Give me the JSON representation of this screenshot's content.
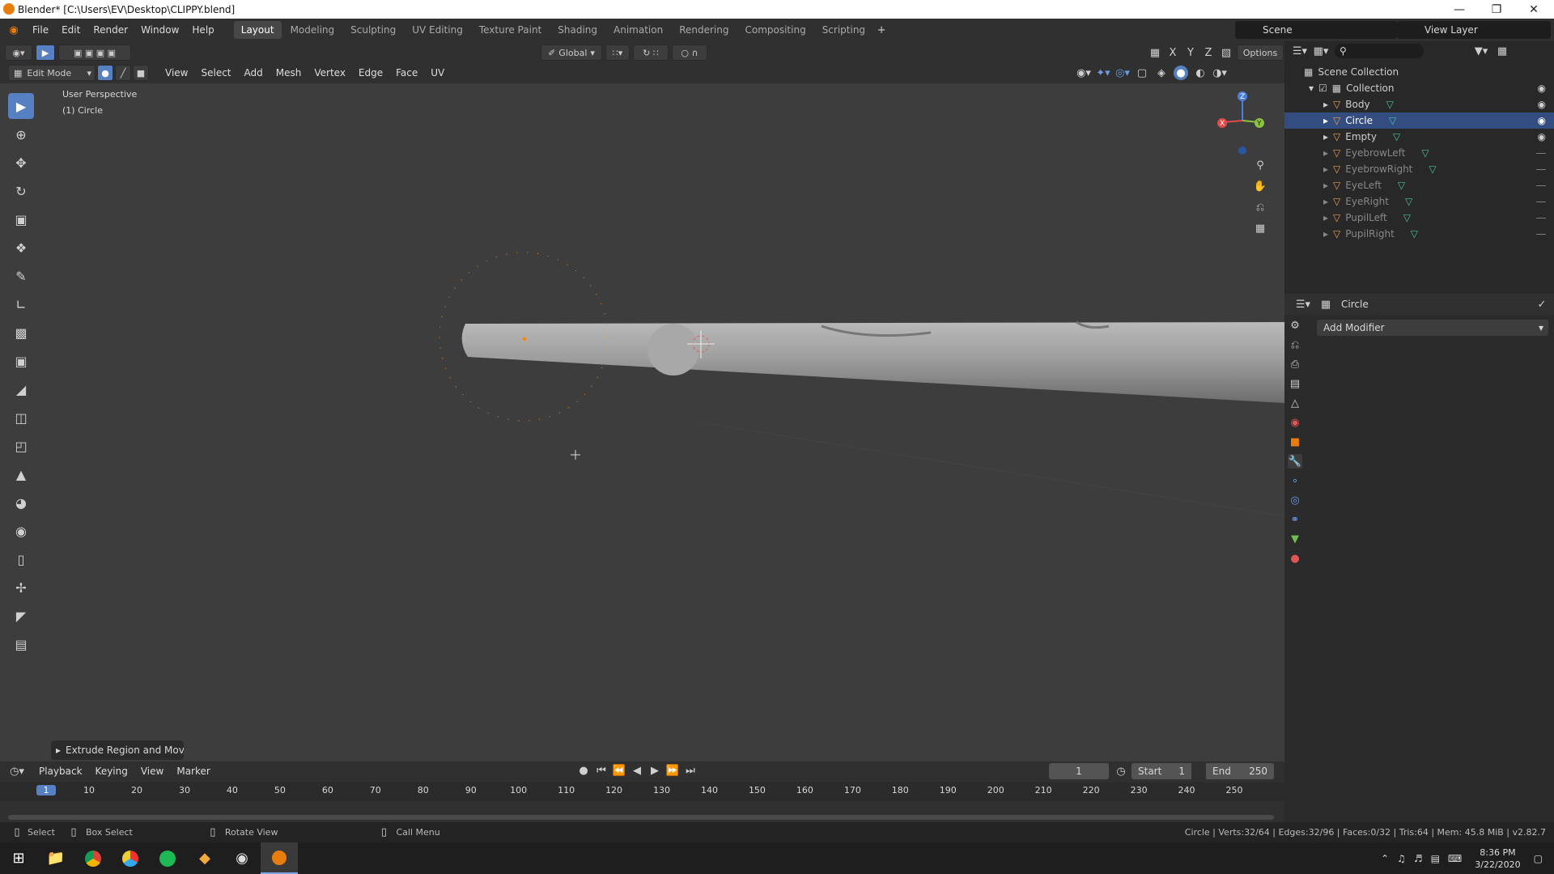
{
  "window": {
    "title": "Blender* [C:\\Users\\EV\\Desktop\\CLIPPY.blend]"
  },
  "menu": [
    "File",
    "Edit",
    "Render",
    "Window",
    "Help"
  ],
  "workspaces": [
    "Layout",
    "Modeling",
    "Sculpting",
    "UV Editing",
    "Texture Paint",
    "Shading",
    "Animation",
    "Rendering",
    "Compositing",
    "Scripting"
  ],
  "scene": {
    "scene_label": "Scene",
    "view_layer_label": "View Layer"
  },
  "header": {
    "transform_orientation": "Global",
    "options_label": "Options",
    "axes": [
      "X",
      "Y",
      "Z"
    ]
  },
  "editmode": {
    "mode_label": "Edit Mode",
    "menus": [
      "View",
      "Select",
      "Add",
      "Mesh",
      "Vertex",
      "Edge",
      "Face",
      "UV"
    ]
  },
  "viewport": {
    "perspective_label": "User Perspective",
    "object_label": "(1) Circle",
    "last_op_label": "Extrude Region and Mov"
  },
  "outliner": {
    "root": "Scene Collection",
    "collection": "Collection",
    "items": [
      {
        "name": "Body",
        "selected": false,
        "dim": false
      },
      {
        "name": "Circle",
        "selected": true,
        "dim": false
      },
      {
        "name": "Empty",
        "selected": false,
        "dim": false
      },
      {
        "name": "EyebrowLeft",
        "selected": false,
        "dim": true
      },
      {
        "name": "EyebrowRight",
        "selected": false,
        "dim": true
      },
      {
        "name": "EyeLeft",
        "selected": false,
        "dim": true
      },
      {
        "name": "EyeRight",
        "selected": false,
        "dim": true
      },
      {
        "name": "PupilLeft",
        "selected": false,
        "dim": true
      },
      {
        "name": "PupilRight",
        "selected": false,
        "dim": true
      }
    ]
  },
  "properties": {
    "object_name": "Circle",
    "add_modifier_label": "Add Modifier"
  },
  "timeline": {
    "menus": [
      "Playback",
      "Keying",
      "View",
      "Marker"
    ],
    "current_frame": "1",
    "start_label": "Start",
    "start_value": "1",
    "end_label": "End",
    "end_value": "250",
    "ruler": [
      "1",
      "10",
      "20",
      "30",
      "40",
      "50",
      "60",
      "70",
      "80",
      "90",
      "100",
      "110",
      "120",
      "130",
      "140",
      "150",
      "160",
      "170",
      "180",
      "190",
      "200",
      "210",
      "220",
      "230",
      "240",
      "250"
    ]
  },
  "status": {
    "select": "Select",
    "box_select": "Box Select",
    "rotate_view": "Rotate View",
    "call_menu": "Call Menu",
    "stats": "Circle | Verts:32/64 | Edges:32/96 | Faces:0/32 | Tris:64 | Mem: 45.8 MiB | v2.82.7"
  },
  "taskbar": {
    "time": "8:36 PM",
    "date": "3/22/2020"
  },
  "colors": {
    "accent": "#5680c2",
    "selection": "#334d80",
    "vertex": "#f28a1f",
    "viewport_bg": "#3d3d3d"
  }
}
